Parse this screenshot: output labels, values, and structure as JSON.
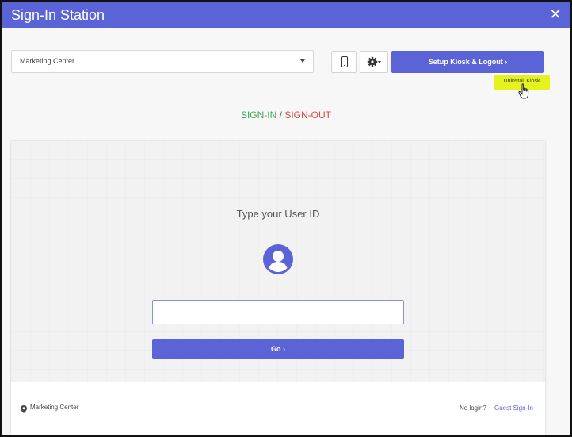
{
  "window": {
    "title": "Sign-In Station",
    "close_icon": "close-icon"
  },
  "toolbar": {
    "location_select_value": "Marketing Center",
    "phone_icon": "mobile-phone-icon",
    "gear_icon": "gear-dropdown-icon",
    "setup_label": "Setup Kiosk & Logout",
    "setup_chevron": "›",
    "tooltip_label": "Uninstall Kiosk"
  },
  "mode": {
    "sign_in": "SIGN-IN",
    "separator": "/",
    "sign_out": "SIGN-OUT",
    "colors": {
      "sign_in": "#3aa655",
      "sign_out": "#d9473f"
    }
  },
  "card": {
    "prompt": "Type your User ID",
    "avatar_icon": "user-avatar-icon",
    "input_value": "",
    "go_label": "Go",
    "go_chevron": "›"
  },
  "footer": {
    "location_icon": "location-pin-icon",
    "location": "Marketing Center",
    "no_login": "No login?",
    "guest_link": "Guest Sign-In"
  },
  "colors": {
    "primary": "#5a64d6",
    "tooltip_highlight": "#e6f21c"
  }
}
